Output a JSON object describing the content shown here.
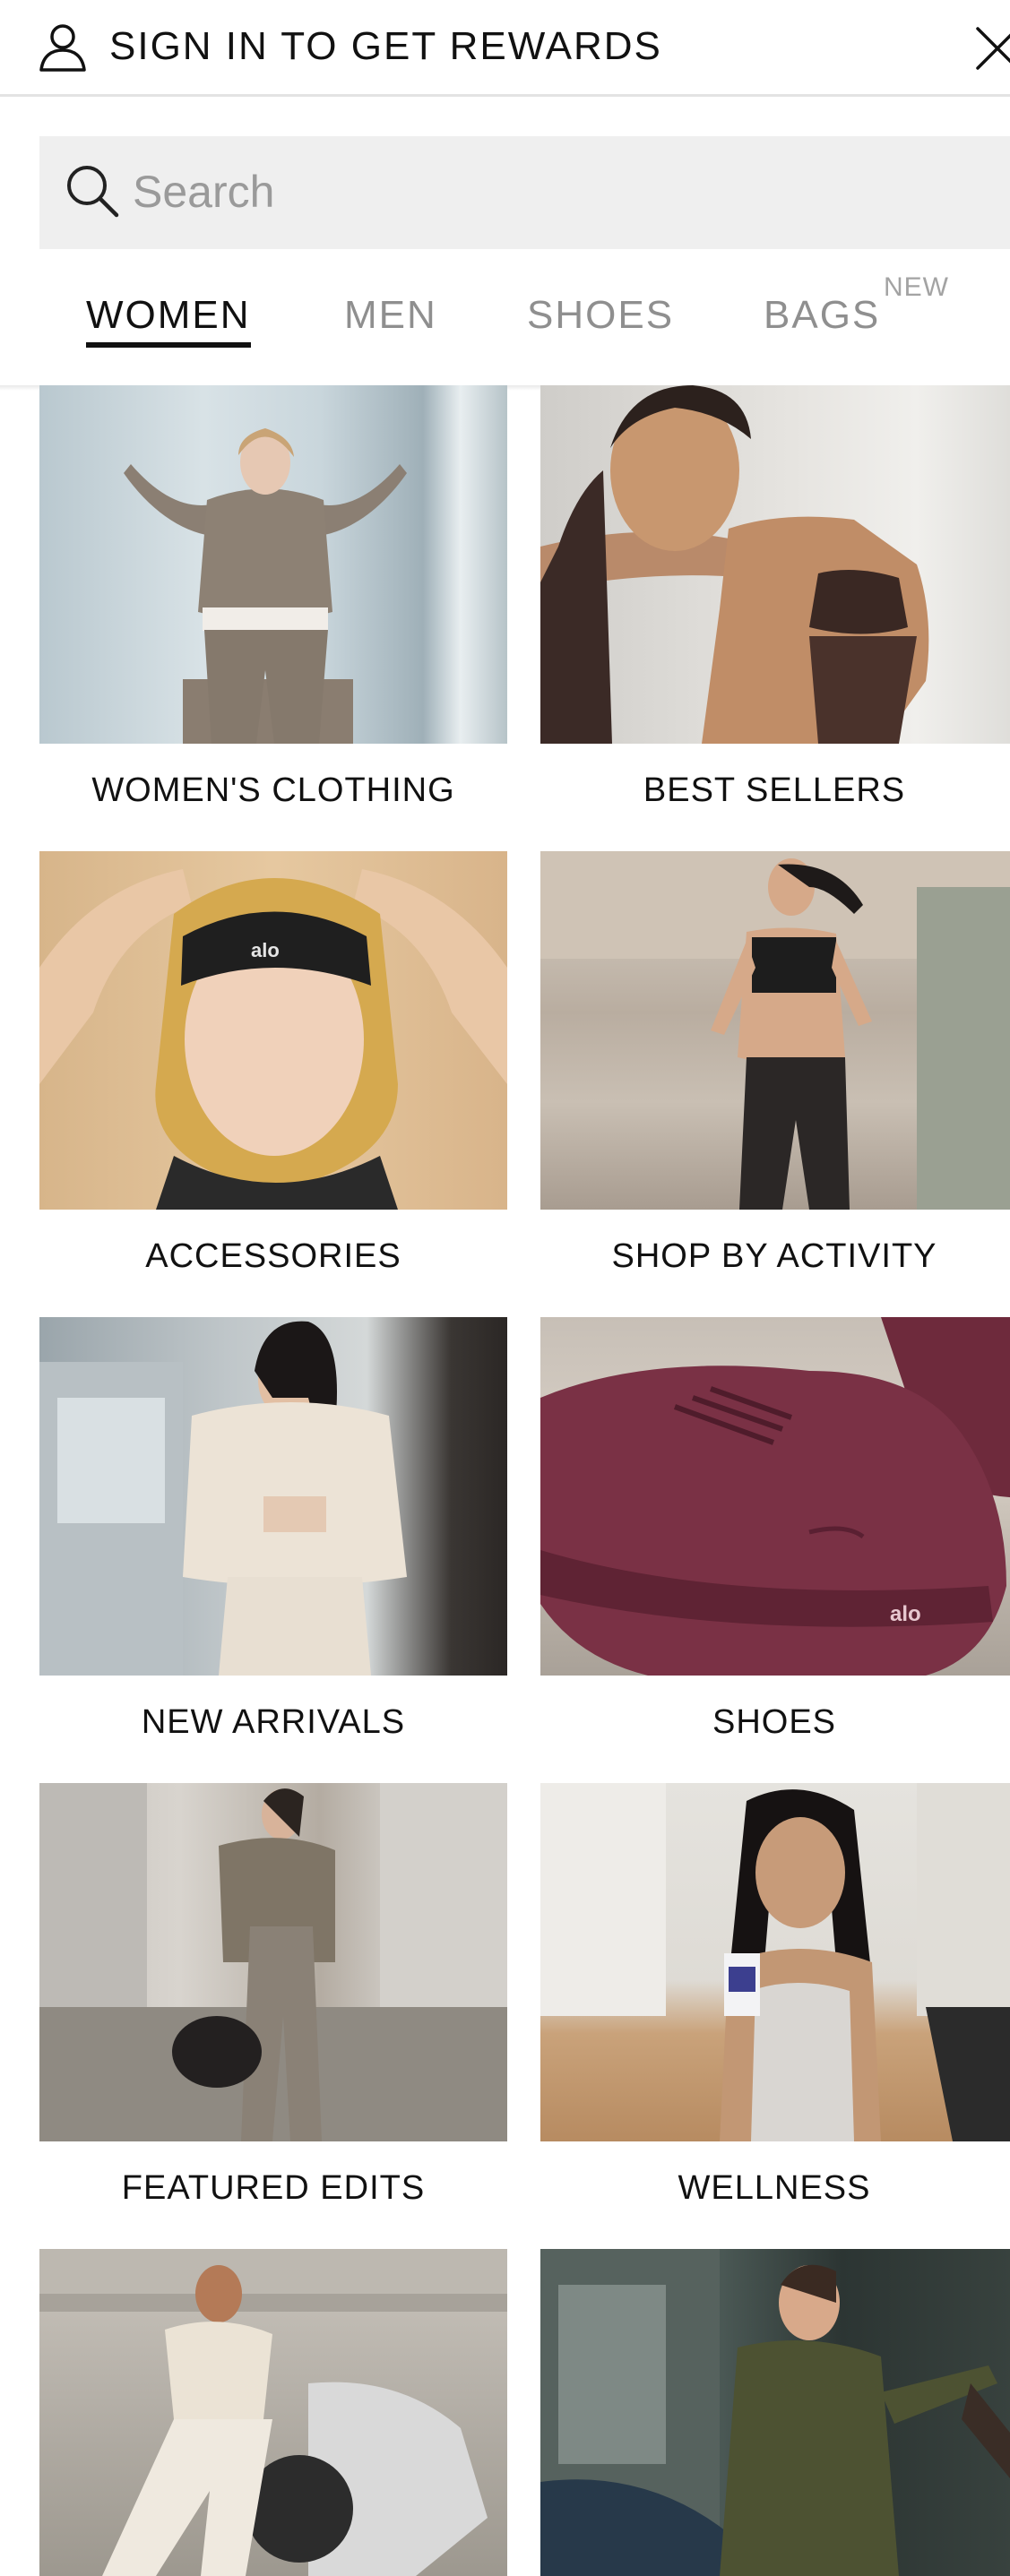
{
  "header": {
    "signin_label": "SIGN IN TO GET REWARDS",
    "user_icon": "user-icon",
    "close_icon": "close-icon"
  },
  "search": {
    "placeholder": "Search",
    "value": "",
    "icon": "search-icon"
  },
  "tabs": [
    {
      "label": "WOMEN",
      "active": true
    },
    {
      "label": "MEN",
      "active": false
    },
    {
      "label": "SHOES",
      "active": false
    },
    {
      "label": "BAGS",
      "active": false,
      "badge": "NEW"
    }
  ],
  "categories": [
    {
      "label": "WOMEN'S CLOTHING"
    },
    {
      "label": "BEST SELLERS"
    },
    {
      "label": "ACCESSORIES"
    },
    {
      "label": "SHOP BY ACTIVITY"
    },
    {
      "label": "NEW ARRIVALS"
    },
    {
      "label": "SHOES"
    },
    {
      "label": "FEATURED EDITS"
    },
    {
      "label": "WELLNESS"
    },
    {
      "label": ""
    },
    {
      "label": ""
    }
  ],
  "brand_mark": "alo",
  "colors": {
    "text": "#111111",
    "muted": "#8f8f8f",
    "search_bg": "#efefef",
    "divider": "#e3e3e3"
  }
}
